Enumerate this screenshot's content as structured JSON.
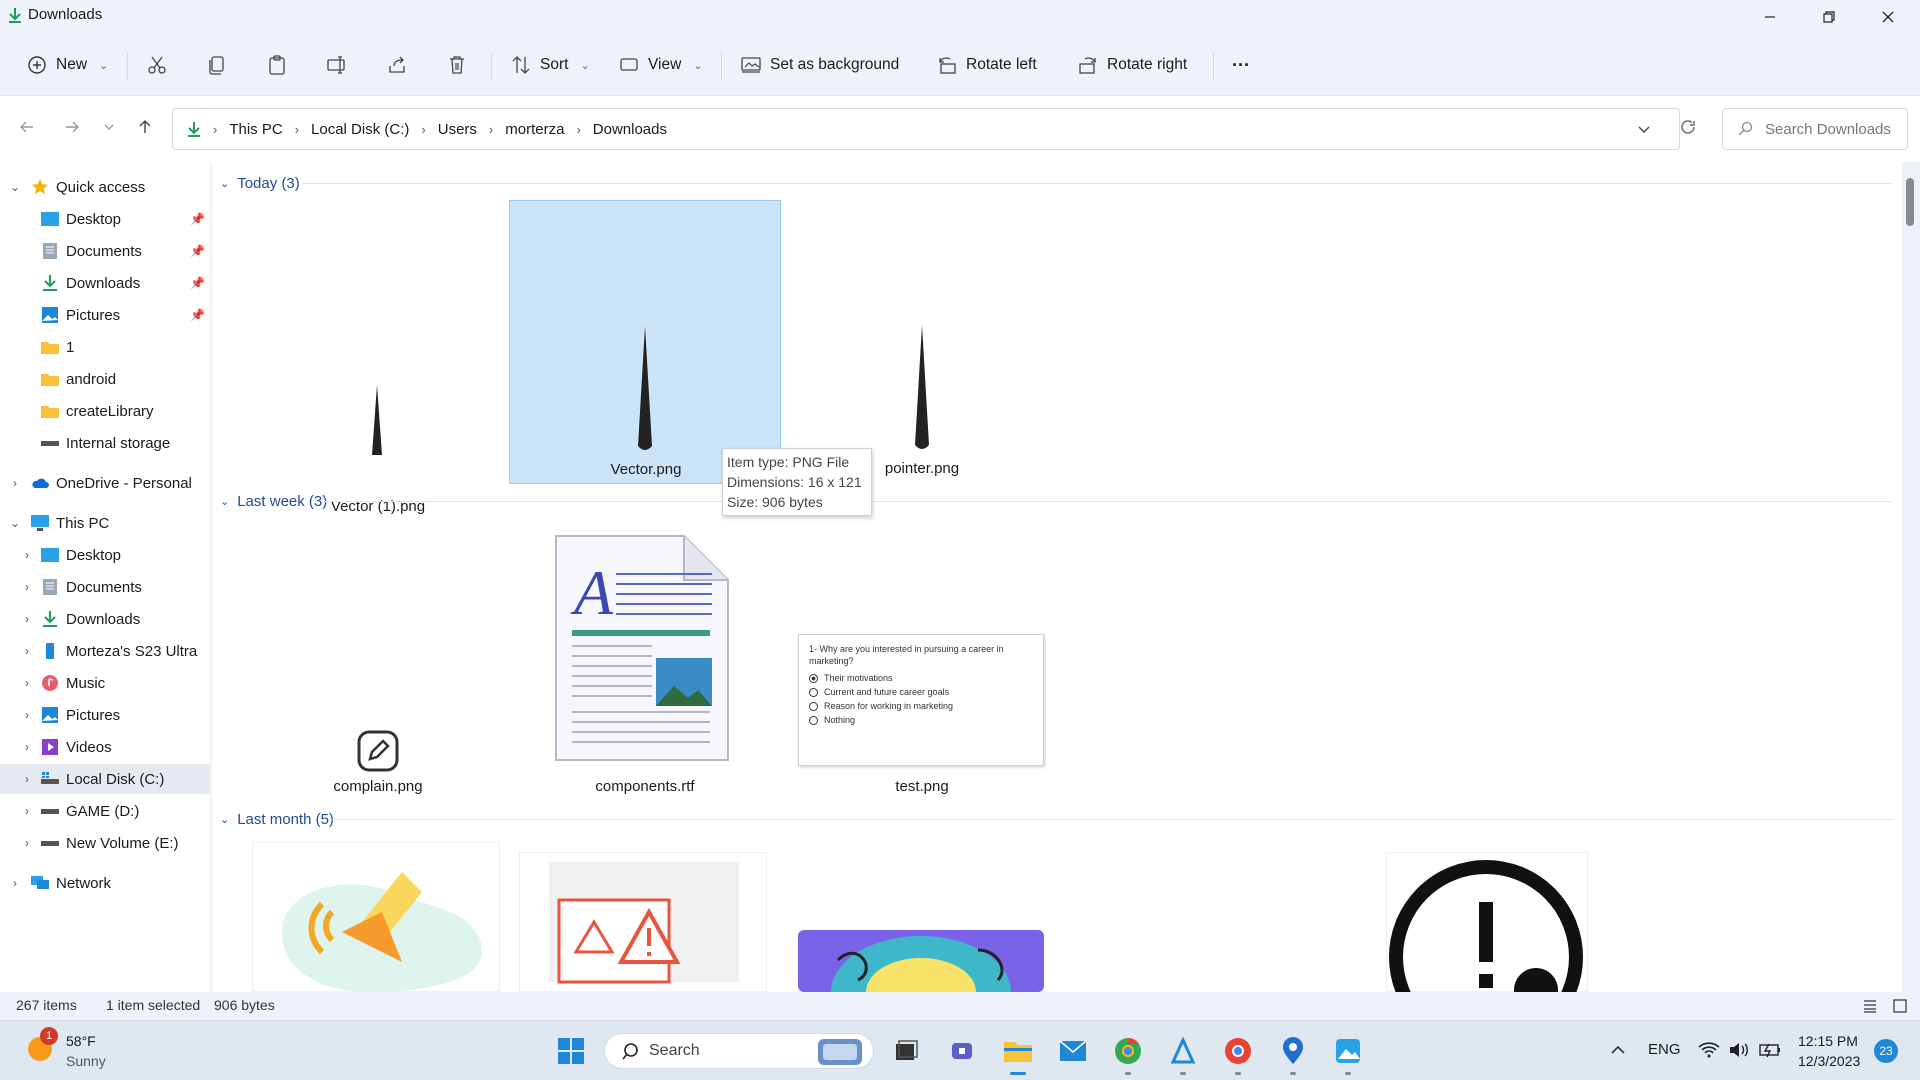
{
  "window": {
    "title": "Downloads"
  },
  "toolbar": {
    "new_label": "New",
    "sort_label": "Sort",
    "view_label": "View",
    "set_background_label": "Set as background",
    "rotate_left_label": "Rotate left",
    "rotate_right_label": "Rotate right",
    "more_label": "···"
  },
  "address": {
    "crumbs": [
      "This PC",
      "Local Disk (C:)",
      "Users",
      "morterza",
      "Downloads"
    ],
    "search_placeholder": "Search Downloads"
  },
  "sidebar": {
    "quick_access": "Quick access",
    "quick_items": [
      "Desktop",
      "Documents",
      "Downloads",
      "Pictures",
      "1",
      "android",
      "createLibrary",
      "Internal storage"
    ],
    "onedrive": "OneDrive - Personal",
    "this_pc": "This PC",
    "pc_items": [
      "Desktop",
      "Documents",
      "Downloads",
      "Morteza's S23 Ultra",
      "Music",
      "Pictures",
      "Videos",
      "Local Disk (C:)",
      "GAME (D:)",
      "New Volume (E:)"
    ],
    "network": "Network"
  },
  "groups": [
    {
      "header": "Today (3)",
      "files": [
        "Vector (1).png",
        "Vector.png",
        "pointer.png"
      ]
    },
    {
      "header": "Last week (3)",
      "files": [
        "complain.png",
        "components.rtf",
        "test.png"
      ]
    },
    {
      "header": "Last month (5)"
    }
  ],
  "tooltip": {
    "line1": "Item type: PNG File",
    "line2": "Dimensions: 16 x 121",
    "line3": "Size: 906 bytes"
  },
  "test_preview": {
    "question": "1- Why are you interested in pursuing a career in marketing?",
    "options": [
      "Their motivations",
      "Current and future career goals",
      "Reason for working in marketing",
      "Nothing"
    ]
  },
  "status": {
    "items": "267 items",
    "selected": "1 item selected",
    "size": "906 bytes"
  },
  "taskbar": {
    "weather_temp": "58°F",
    "weather_desc": "Sunny",
    "weather_badge": "1",
    "search_label": "Search",
    "lang": "ENG",
    "time": "12:15 PM",
    "date": "12/3/2023",
    "notif_count": "23"
  },
  "colors": {
    "accent": "#0067c0",
    "selection": "#cce4f7",
    "group_header": "#1f4a9a"
  }
}
